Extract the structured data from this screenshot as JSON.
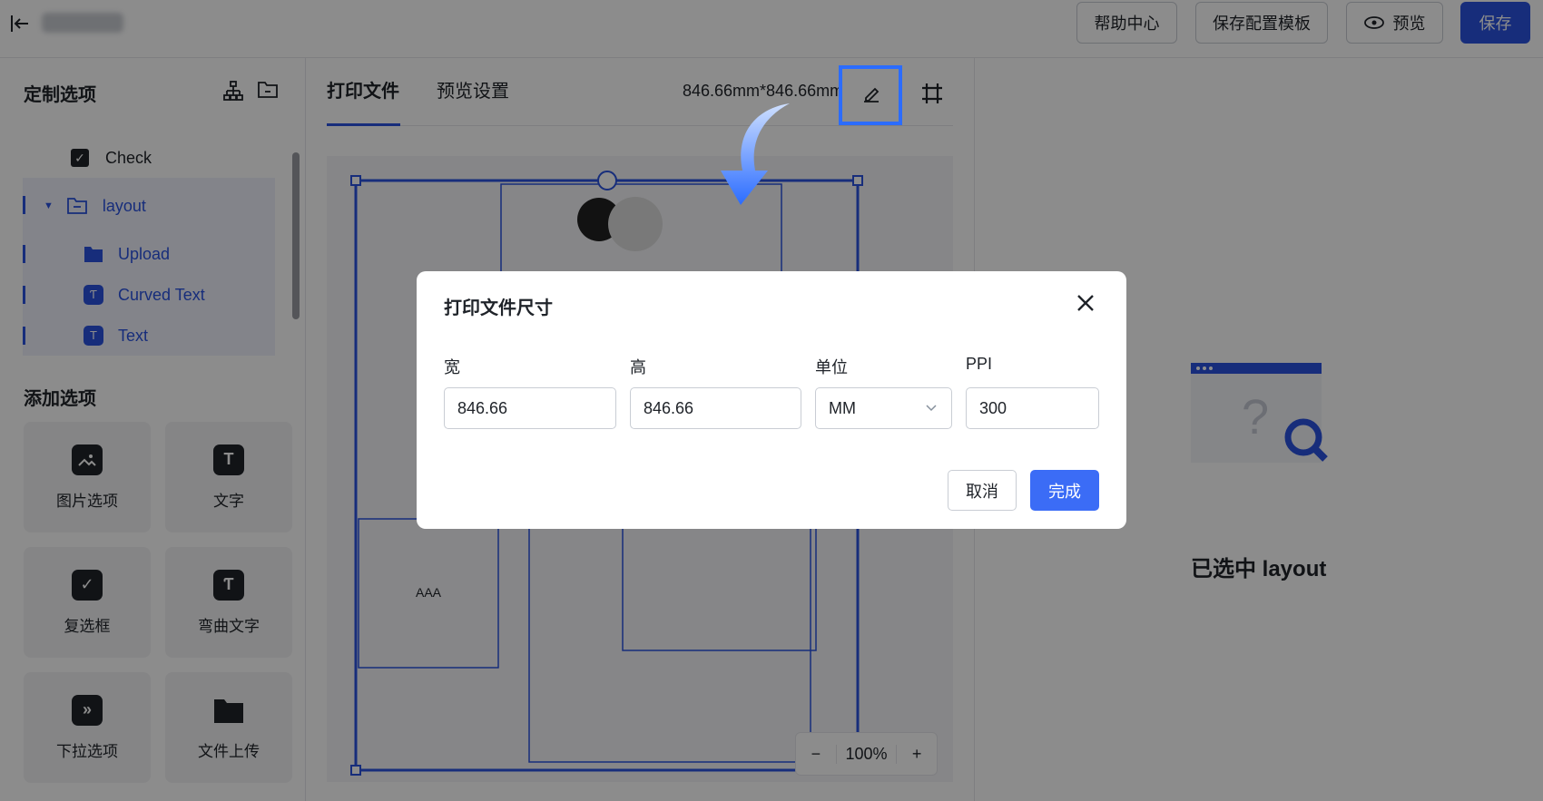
{
  "header": {
    "help_label": "帮助中心",
    "save_template_label": "保存配置模板",
    "preview_label": "预览",
    "save_label": "保存"
  },
  "sidebar": {
    "custom_title": "定制选项",
    "tree": [
      {
        "label": "Check",
        "icon": "checkbox-icon"
      },
      {
        "label": "layout",
        "icon": "folder-icon"
      },
      {
        "label": "Upload",
        "icon": "folder-icon"
      },
      {
        "label": "Curved Text",
        "icon": "curved-text-icon"
      },
      {
        "label": "Text",
        "icon": "text-icon"
      }
    ],
    "add_title": "添加选项",
    "cards": [
      {
        "label": "图片选项",
        "icon": "image-icon"
      },
      {
        "label": "文字",
        "icon": "text-icon"
      },
      {
        "label": "复选框",
        "icon": "checkbox-icon"
      },
      {
        "label": "弯曲文字",
        "icon": "curved-text-icon"
      },
      {
        "label": "下拉选项",
        "icon": "dropdown-icon"
      },
      {
        "label": "文件上传",
        "icon": "folder-icon"
      }
    ]
  },
  "canvas": {
    "tabs": [
      "打印文件",
      "预览设置"
    ],
    "size_text": "846.66mm*846.66mm",
    "sample_text": "AAA",
    "zoom": "100%"
  },
  "right_panel": {
    "selected_text": "已选中 layout"
  },
  "modal": {
    "title": "打印文件尺寸",
    "width_label": "宽",
    "width_value": "846.66",
    "height_label": "高",
    "height_value": "846.66",
    "unit_label": "单位",
    "unit_value": "MM",
    "ppi_label": "PPI",
    "ppi_value": "300",
    "cancel_label": "取消",
    "confirm_label": "完成"
  },
  "colors": {
    "primary": "#2b53e0",
    "highlight": "#2b6cff"
  }
}
